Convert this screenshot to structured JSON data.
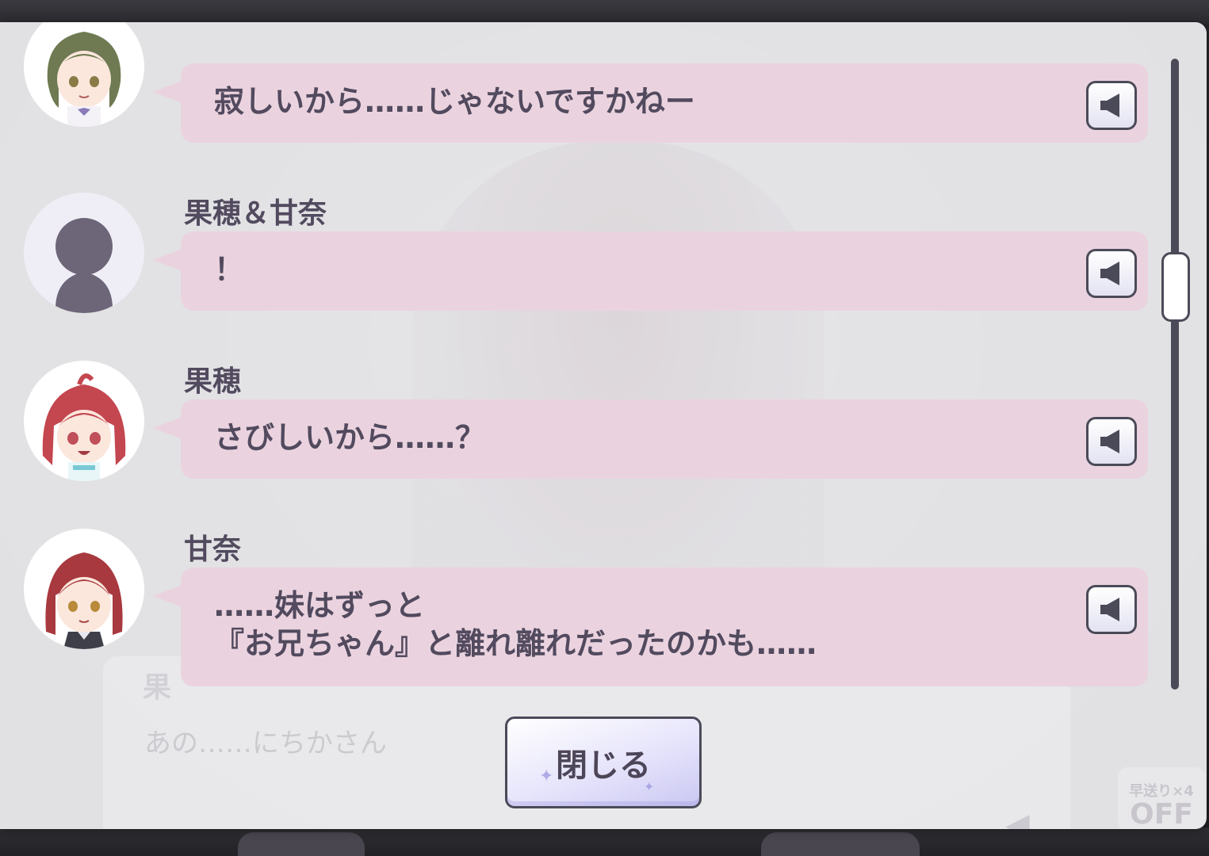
{
  "log": {
    "entries": [
      {
        "speaker": "",
        "avatar": "green-hair-girl-avatar",
        "text": "寂しいから……じゃないですかねー"
      },
      {
        "speaker": "果穂＆甘奈",
        "avatar": "silhouette-avatar",
        "text": "！"
      },
      {
        "speaker": "果穂",
        "avatar": "red-hair-girl-avatar",
        "text": "さびしいから……？"
      },
      {
        "speaker": "甘奈",
        "avatar": "auburn-hair-girl-avatar",
        "text": "……妹はずっと\n『お兄ちゃん』と離れ離れだったのかも……"
      }
    ]
  },
  "close_button": {
    "label": "閉じる"
  },
  "background_dialog": {
    "name": "果",
    "line": "あの……にちかさん",
    "fast_forward_label": "早送り×4",
    "fast_forward_state": "OFF"
  },
  "colors": {
    "bubble": "#ead3df",
    "text": "#524a5e",
    "border": "#4b4a58",
    "modal": "#f0f0f2"
  }
}
